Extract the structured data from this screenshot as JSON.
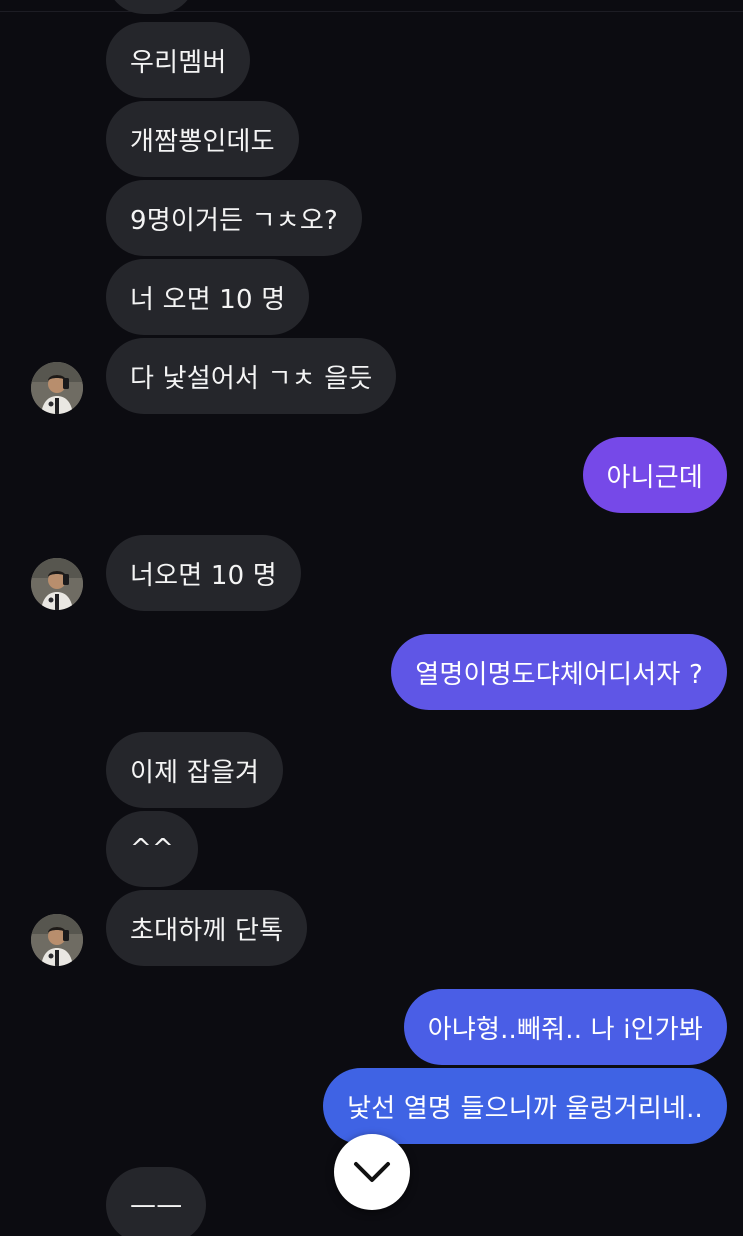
{
  "colors": {
    "background": "#0c0c11",
    "incoming_bubble": "#25262b",
    "outgoing_purple": "#7649e8",
    "outgoing_blue": "#3f63e4"
  },
  "messages": [
    {
      "from": "them",
      "text": "우리멤버"
    },
    {
      "from": "them",
      "text": "개짬뽕인데도"
    },
    {
      "from": "them",
      "text": "9명이거든 ㄱㅊ오?"
    },
    {
      "from": "them",
      "text": "너 오면 10 명"
    },
    {
      "from": "them",
      "text": "다 낯설어서 ㄱㅊ 을듯",
      "avatar": "profile-photo"
    },
    {
      "from": "me",
      "text": "아니근데"
    },
    {
      "from": "them",
      "text": "너오면 10 명",
      "avatar": "profile-photo"
    },
    {
      "from": "me",
      "text": "열명이명도댜체어디서자 ?"
    },
    {
      "from": "them",
      "text": "이제 잡을겨"
    },
    {
      "from": "them",
      "text": "^^"
    },
    {
      "from": "them",
      "text": "초대하께 단톡",
      "avatar": "profile-photo"
    },
    {
      "from": "me",
      "text": "아냐형..빼줘.. 나 i인가봐"
    },
    {
      "from": "me",
      "text": "낯선 열명 들으니까 울렁거리네.."
    },
    {
      "from": "them",
      "text": "——"
    }
  ],
  "scroll_button": {
    "icon": "chevron-down-icon"
  }
}
